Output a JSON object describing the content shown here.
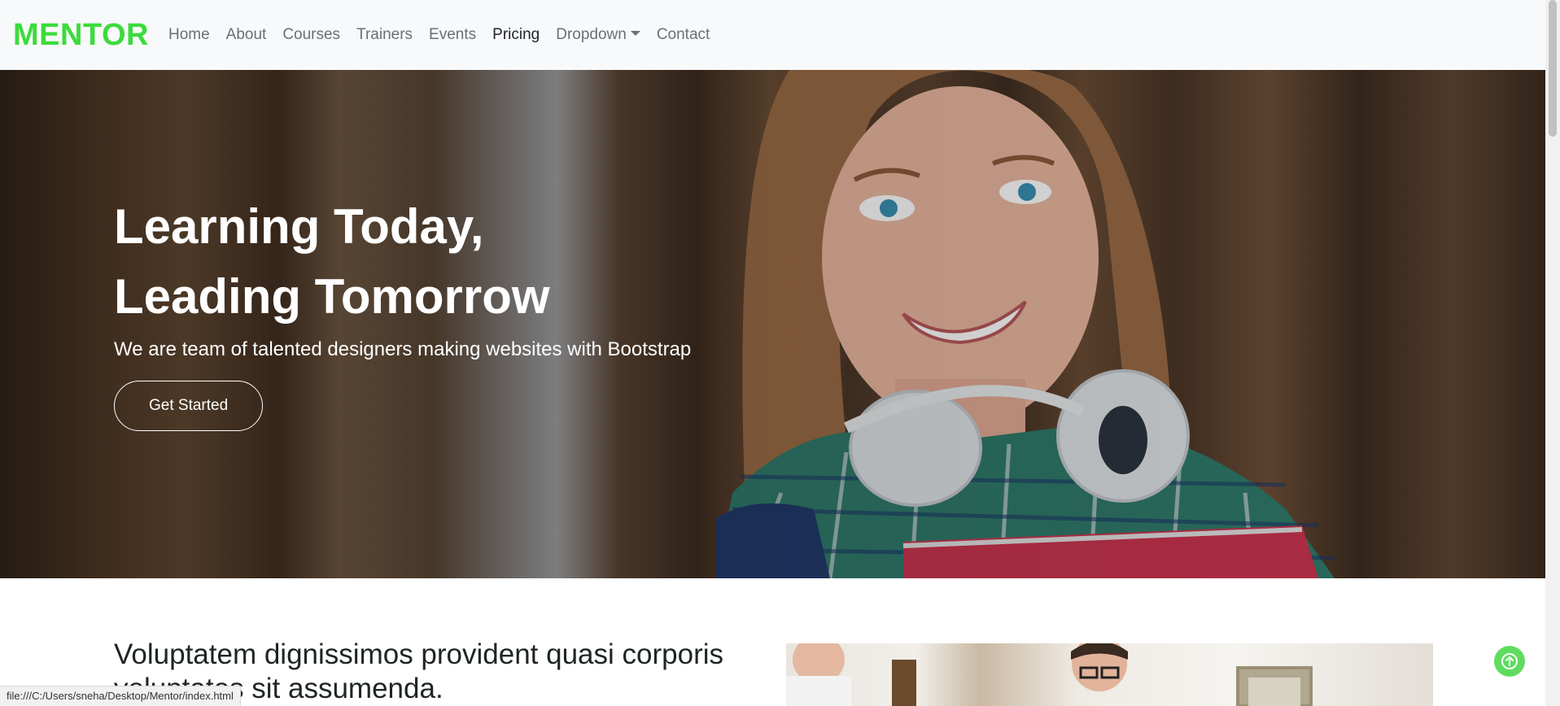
{
  "navbar": {
    "brand": "MENTOR",
    "links": [
      {
        "label": "Home"
      },
      {
        "label": "About"
      },
      {
        "label": "Courses"
      },
      {
        "label": "Trainers"
      },
      {
        "label": "Events"
      },
      {
        "label": "Pricing"
      },
      {
        "label": "Dropdown"
      },
      {
        "label": "Contact"
      }
    ],
    "active": "Pricing"
  },
  "hero": {
    "title_line1": "Learning Today,",
    "title_line2": "Leading Tomorrow",
    "subtitle": "We are team of talented designers making websites with Bootstrap",
    "button_label": "Get Started"
  },
  "about": {
    "title": "Voluptatem dignissimos provident quasi corporis voluptates sit assumenda."
  },
  "status_bar": {
    "url": "file:///C:/Users/sneha/Desktop/Mentor/index.html"
  },
  "colors": {
    "brand": "#3cdb3c",
    "back_to_top": "#5fdc5f",
    "navbar_bg": "#f8f9fa"
  },
  "icons": {
    "back_to_top": "arrow-up-icon",
    "dropdown": "caret-down-icon"
  }
}
